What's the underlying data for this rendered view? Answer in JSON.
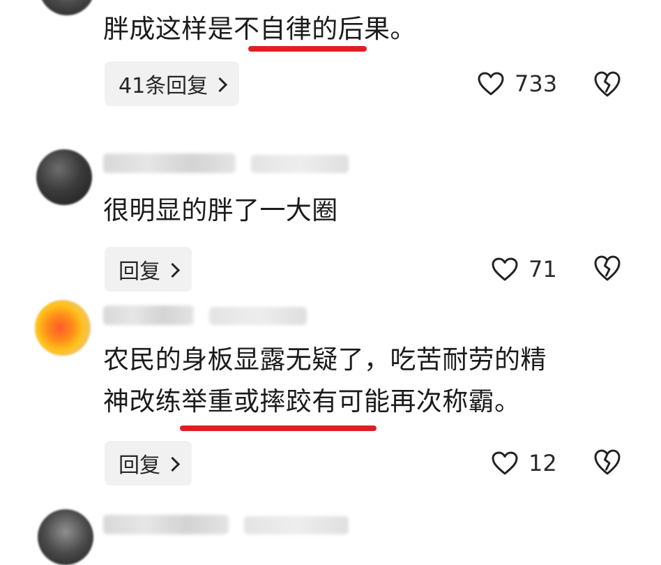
{
  "comments": [
    {
      "content": "胖成这样是不自律的后果。",
      "reply_label": "41条回复",
      "like_count": "733"
    },
    {
      "content": "很明显的胖了一大圈",
      "reply_label": "回复",
      "like_count": "71"
    },
    {
      "content_line1": "农民的身板显露无疑了，吃苦耐劳的精",
      "content_line2": "神改练举重或摔跤有可能再次称霸。",
      "reply_label": "回复",
      "like_count": "12"
    }
  ],
  "colors": {
    "underline": "#e02020",
    "text": "#1b1b1b",
    "reply_bg": "#f1f1f1"
  },
  "icons": {
    "like": "heart-outline-icon",
    "dislike": "broken-heart-icon",
    "reply_chevron": "chevron-right-icon"
  }
}
